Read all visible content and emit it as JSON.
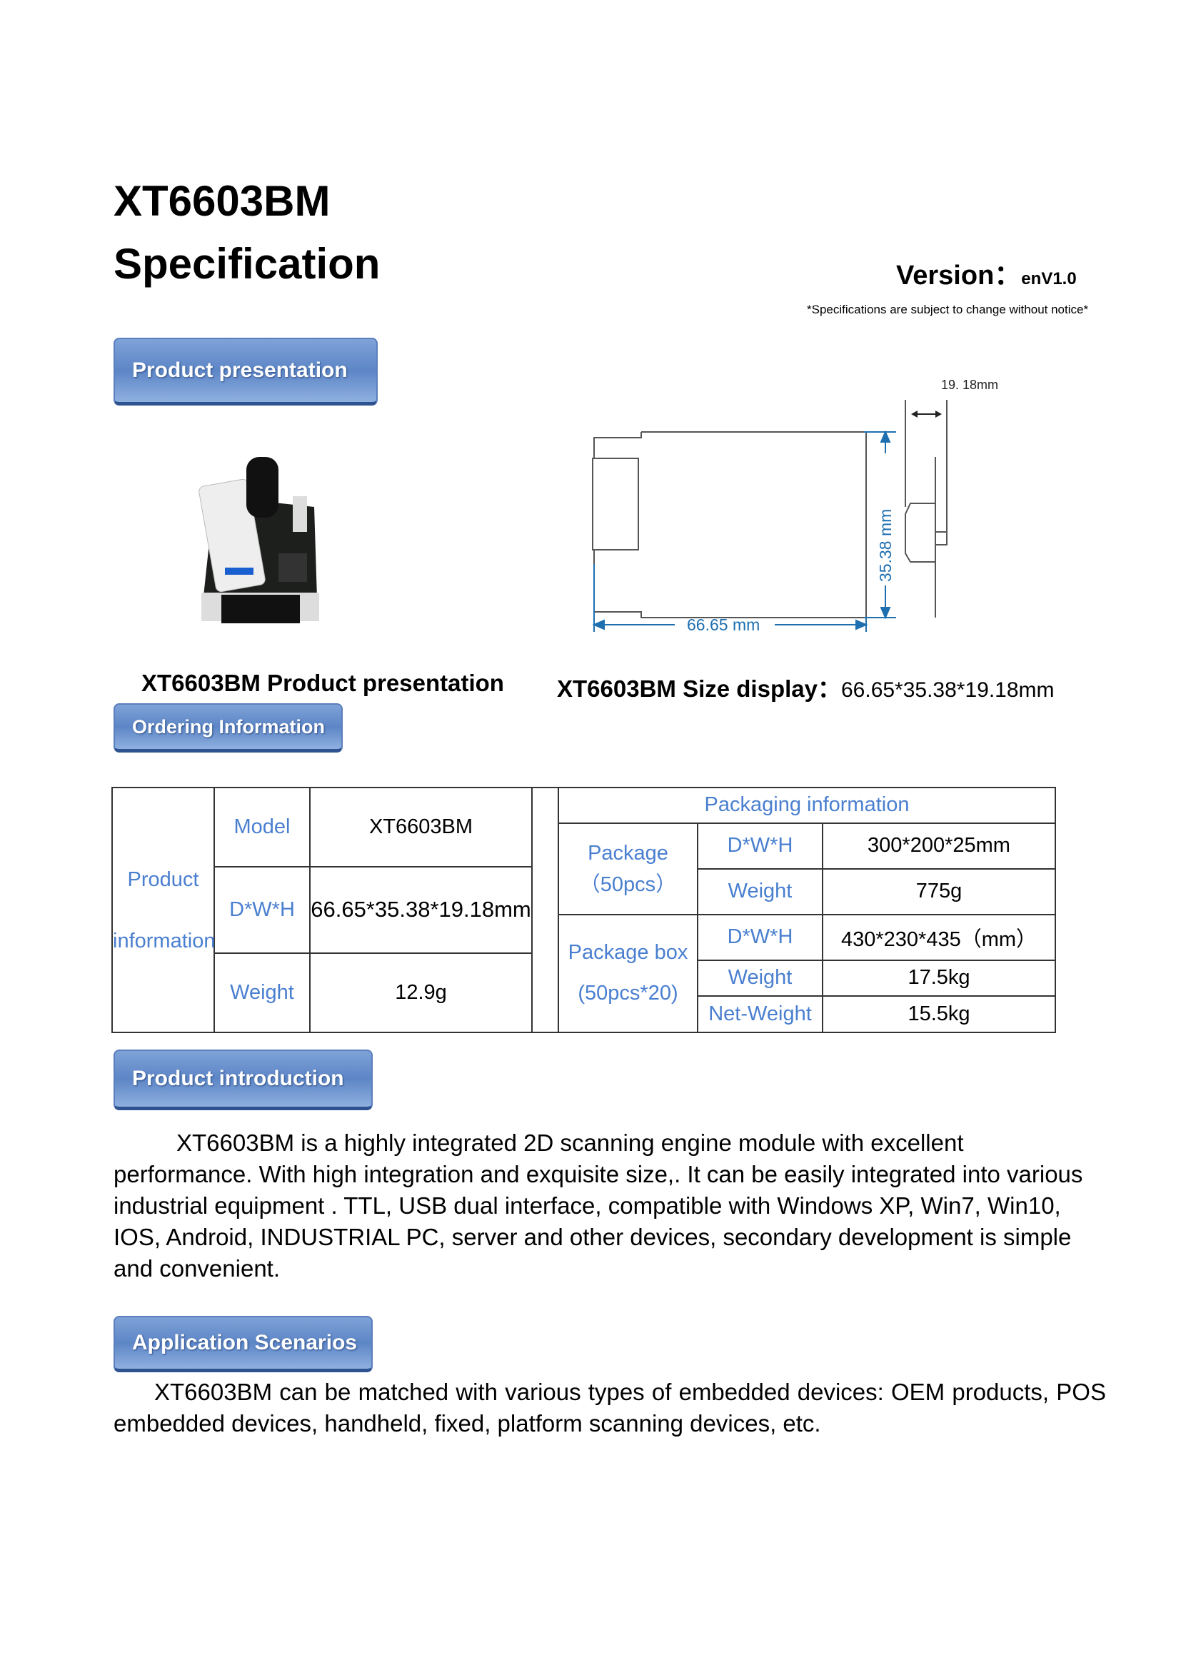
{
  "header": {
    "title_line1": "XT6603BM",
    "title_line2": "Specification",
    "version_label": "Version：",
    "version_value": "enV1.0",
    "notice": "*Specifications are subject to change without notice*"
  },
  "sections": {
    "presentation": "Product presentation",
    "ordering": "Ordering Information",
    "introduction": "Product introduction",
    "applications": "Application Scenarios"
  },
  "drawing": {
    "width_dim": "66.65 mm",
    "height_dim": "35.38 mm",
    "depth_dim": "19. 18mm"
  },
  "captions": {
    "photo": "XT6603BM Product presentation",
    "size_label": "XT6603BM Size display：",
    "size_value": "66.65*35.38*19.18mm"
  },
  "product_table": {
    "group": [
      "Product",
      "information"
    ],
    "rows": [
      {
        "label": "Model",
        "value": "XT6603BM"
      },
      {
        "label": "D*W*H",
        "value": "66.65*35.38*19.18mm"
      },
      {
        "label": "Weight",
        "value": "12.9g"
      }
    ]
  },
  "packaging_table": {
    "header": "Packaging information",
    "package": {
      "name": "Package",
      "qty": "（50pcs）",
      "rows": [
        {
          "label": "D*W*H",
          "value": "300*200*25mm"
        },
        {
          "label": "Weight",
          "value": "775g"
        }
      ]
    },
    "box": {
      "name": "Package box",
      "qty": "(50pcs*20)",
      "rows": [
        {
          "label": "D*W*H",
          "value": "430*230*435（mm）"
        },
        {
          "label": "Weight",
          "value": "17.5kg"
        },
        {
          "label": "Net-Weight",
          "value": "15.5kg"
        }
      ]
    }
  },
  "introduction_text": "XT6603BM is a highly integrated 2D scanning engine module with excellent performance. With high integration and exquisite size,. It can be easily integrated into various industrial equipment . TTL, USB dual interface, compatible with Windows XP, Win7, Win10, IOS, Android, INDUSTRIAL PC, server and other devices, secondary development is simple and convenient.",
  "applications_text": "XT6603BM can be matched with various types of embedded devices: OEM products, POS embedded devices, handheld, fixed, platform scanning devices, etc.",
  "colors": {
    "label_blue": "#4a7fd0",
    "banner_blue": "#6b90cf",
    "dim_blue": "#1e6fb0"
  }
}
